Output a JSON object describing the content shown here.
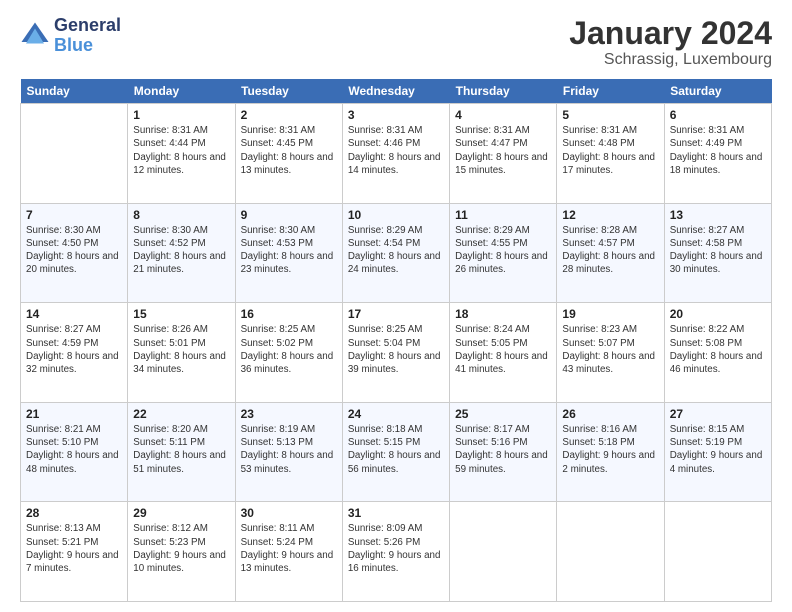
{
  "header": {
    "logo_line1": "General",
    "logo_line2": "Blue",
    "month": "January 2024",
    "location": "Schrassig, Luxembourg"
  },
  "days_of_week": [
    "Sunday",
    "Monday",
    "Tuesday",
    "Wednesday",
    "Thursday",
    "Friday",
    "Saturday"
  ],
  "weeks": [
    [
      {
        "day": "",
        "sunrise": "",
        "sunset": "",
        "daylight": ""
      },
      {
        "day": "1",
        "sunrise": "Sunrise: 8:31 AM",
        "sunset": "Sunset: 4:44 PM",
        "daylight": "Daylight: 8 hours and 12 minutes."
      },
      {
        "day": "2",
        "sunrise": "Sunrise: 8:31 AM",
        "sunset": "Sunset: 4:45 PM",
        "daylight": "Daylight: 8 hours and 13 minutes."
      },
      {
        "day": "3",
        "sunrise": "Sunrise: 8:31 AM",
        "sunset": "Sunset: 4:46 PM",
        "daylight": "Daylight: 8 hours and 14 minutes."
      },
      {
        "day": "4",
        "sunrise": "Sunrise: 8:31 AM",
        "sunset": "Sunset: 4:47 PM",
        "daylight": "Daylight: 8 hours and 15 minutes."
      },
      {
        "day": "5",
        "sunrise": "Sunrise: 8:31 AM",
        "sunset": "Sunset: 4:48 PM",
        "daylight": "Daylight: 8 hours and 17 minutes."
      },
      {
        "day": "6",
        "sunrise": "Sunrise: 8:31 AM",
        "sunset": "Sunset: 4:49 PM",
        "daylight": "Daylight: 8 hours and 18 minutes."
      }
    ],
    [
      {
        "day": "7",
        "sunrise": "Sunrise: 8:30 AM",
        "sunset": "Sunset: 4:50 PM",
        "daylight": "Daylight: 8 hours and 20 minutes."
      },
      {
        "day": "8",
        "sunrise": "Sunrise: 8:30 AM",
        "sunset": "Sunset: 4:52 PM",
        "daylight": "Daylight: 8 hours and 21 minutes."
      },
      {
        "day": "9",
        "sunrise": "Sunrise: 8:30 AM",
        "sunset": "Sunset: 4:53 PM",
        "daylight": "Daylight: 8 hours and 23 minutes."
      },
      {
        "day": "10",
        "sunrise": "Sunrise: 8:29 AM",
        "sunset": "Sunset: 4:54 PM",
        "daylight": "Daylight: 8 hours and 24 minutes."
      },
      {
        "day": "11",
        "sunrise": "Sunrise: 8:29 AM",
        "sunset": "Sunset: 4:55 PM",
        "daylight": "Daylight: 8 hours and 26 minutes."
      },
      {
        "day": "12",
        "sunrise": "Sunrise: 8:28 AM",
        "sunset": "Sunset: 4:57 PM",
        "daylight": "Daylight: 8 hours and 28 minutes."
      },
      {
        "day": "13",
        "sunrise": "Sunrise: 8:27 AM",
        "sunset": "Sunset: 4:58 PM",
        "daylight": "Daylight: 8 hours and 30 minutes."
      }
    ],
    [
      {
        "day": "14",
        "sunrise": "Sunrise: 8:27 AM",
        "sunset": "Sunset: 4:59 PM",
        "daylight": "Daylight: 8 hours and 32 minutes."
      },
      {
        "day": "15",
        "sunrise": "Sunrise: 8:26 AM",
        "sunset": "Sunset: 5:01 PM",
        "daylight": "Daylight: 8 hours and 34 minutes."
      },
      {
        "day": "16",
        "sunrise": "Sunrise: 8:25 AM",
        "sunset": "Sunset: 5:02 PM",
        "daylight": "Daylight: 8 hours and 36 minutes."
      },
      {
        "day": "17",
        "sunrise": "Sunrise: 8:25 AM",
        "sunset": "Sunset: 5:04 PM",
        "daylight": "Daylight: 8 hours and 39 minutes."
      },
      {
        "day": "18",
        "sunrise": "Sunrise: 8:24 AM",
        "sunset": "Sunset: 5:05 PM",
        "daylight": "Daylight: 8 hours and 41 minutes."
      },
      {
        "day": "19",
        "sunrise": "Sunrise: 8:23 AM",
        "sunset": "Sunset: 5:07 PM",
        "daylight": "Daylight: 8 hours and 43 minutes."
      },
      {
        "day": "20",
        "sunrise": "Sunrise: 8:22 AM",
        "sunset": "Sunset: 5:08 PM",
        "daylight": "Daylight: 8 hours and 46 minutes."
      }
    ],
    [
      {
        "day": "21",
        "sunrise": "Sunrise: 8:21 AM",
        "sunset": "Sunset: 5:10 PM",
        "daylight": "Daylight: 8 hours and 48 minutes."
      },
      {
        "day": "22",
        "sunrise": "Sunrise: 8:20 AM",
        "sunset": "Sunset: 5:11 PM",
        "daylight": "Daylight: 8 hours and 51 minutes."
      },
      {
        "day": "23",
        "sunrise": "Sunrise: 8:19 AM",
        "sunset": "Sunset: 5:13 PM",
        "daylight": "Daylight: 8 hours and 53 minutes."
      },
      {
        "day": "24",
        "sunrise": "Sunrise: 8:18 AM",
        "sunset": "Sunset: 5:15 PM",
        "daylight": "Daylight: 8 hours and 56 minutes."
      },
      {
        "day": "25",
        "sunrise": "Sunrise: 8:17 AM",
        "sunset": "Sunset: 5:16 PM",
        "daylight": "Daylight: 8 hours and 59 minutes."
      },
      {
        "day": "26",
        "sunrise": "Sunrise: 8:16 AM",
        "sunset": "Sunset: 5:18 PM",
        "daylight": "Daylight: 9 hours and 2 minutes."
      },
      {
        "day": "27",
        "sunrise": "Sunrise: 8:15 AM",
        "sunset": "Sunset: 5:19 PM",
        "daylight": "Daylight: 9 hours and 4 minutes."
      }
    ],
    [
      {
        "day": "28",
        "sunrise": "Sunrise: 8:13 AM",
        "sunset": "Sunset: 5:21 PM",
        "daylight": "Daylight: 9 hours and 7 minutes."
      },
      {
        "day": "29",
        "sunrise": "Sunrise: 8:12 AM",
        "sunset": "Sunset: 5:23 PM",
        "daylight": "Daylight: 9 hours and 10 minutes."
      },
      {
        "day": "30",
        "sunrise": "Sunrise: 8:11 AM",
        "sunset": "Sunset: 5:24 PM",
        "daylight": "Daylight: 9 hours and 13 minutes."
      },
      {
        "day": "31",
        "sunrise": "Sunrise: 8:09 AM",
        "sunset": "Sunset: 5:26 PM",
        "daylight": "Daylight: 9 hours and 16 minutes."
      },
      {
        "day": "",
        "sunrise": "",
        "sunset": "",
        "daylight": ""
      },
      {
        "day": "",
        "sunrise": "",
        "sunset": "",
        "daylight": ""
      },
      {
        "day": "",
        "sunrise": "",
        "sunset": "",
        "daylight": ""
      }
    ]
  ]
}
